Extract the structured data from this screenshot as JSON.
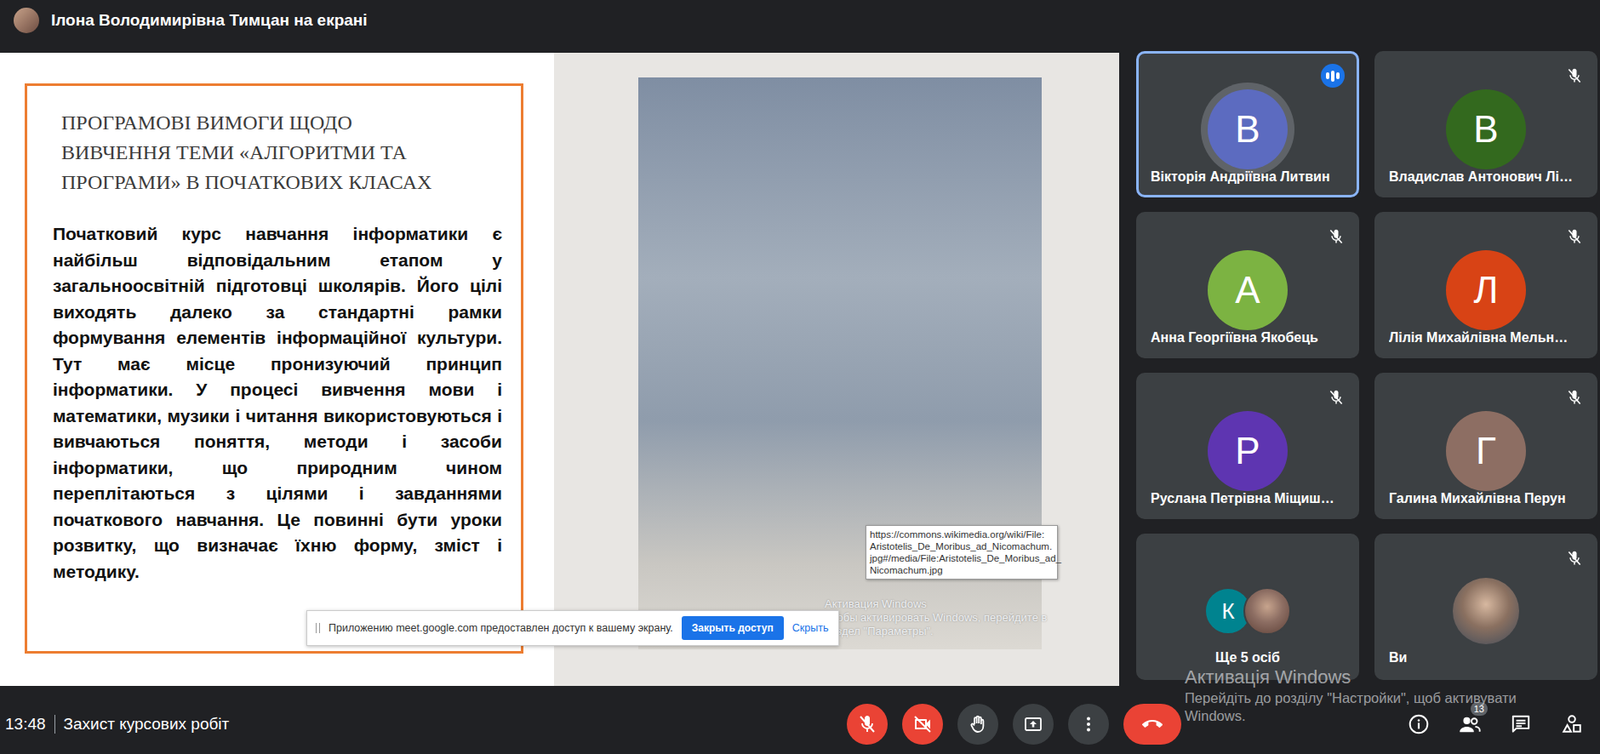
{
  "top_bar": {
    "presenter": "Ілона Володимирівна Тимцан на екрані"
  },
  "slide": {
    "title_lines": [
      "ПРОГРАМОВІ ВИМОГИ ЩОДО",
      "ВИВЧЕННЯ ТЕМИ «АЛГОРИТМИ ТА",
      "ПРОГРАМИ» В ПОЧАТКОВИХ КЛАСАХ"
    ],
    "body": "Початковий курс навчання інформатики є найбільш відповідальним етапом у загальноосвітній підготовці школярів. Його цілі виходять далеко за стандартні рамки формування елементів інформаційної культури. Тут має місце пронизуючий принцип інформатики. У процесі вивчення мови і математики, музики і читання використовуються і вивчаються поняття, методи і засоби інформатики, що природним чином переплітаються з цілями і завданнями початкового навчання. Це повинні бути уроки розвитку, що визначає їхню форму, зміст і методику."
  },
  "tooltip_lines": [
    "https://commons.wikimedia.org/wiki/File:",
    "Aristotelis_De_Moribus_ad_Nicomachum.",
    "jpg#/media/File:Aristotelis_De_Moribus_ad_",
    "Nicomachum.jpg"
  ],
  "shared_watermark": [
    "Активация Windows",
    "Чтобы активировать Windows, перейдите в",
    "раздел \"Параметры\"."
  ],
  "share_bar": {
    "message": "Приложению meet.google.com предоставлен доступ к вашему экрану.",
    "stop_button": "Закрыть доступ",
    "hide_link": "Скрыть"
  },
  "participants": [
    {
      "kind": "person",
      "initial": "В",
      "name": "Вікторія Андріївна Литвин",
      "color": "#5c6bc0",
      "muted": false,
      "speaking": true
    },
    {
      "kind": "person",
      "initial": "В",
      "name": "Владислав Антонович Лі…",
      "color": "#33691e",
      "muted": true,
      "speaking": false
    },
    {
      "kind": "person",
      "initial": "А",
      "name": "Анна Георгіївна Якобець",
      "color": "#7cb342",
      "muted": true,
      "speaking": false
    },
    {
      "kind": "person",
      "initial": "Л",
      "name": "Лілія Михайлівна Мельн…",
      "color": "#d84315",
      "muted": true,
      "speaking": false
    },
    {
      "kind": "person",
      "initial": "Р",
      "name": "Руслана Петрівна Міщиш…",
      "color": "#5e35b1",
      "muted": true,
      "speaking": false
    },
    {
      "kind": "person",
      "initial": "Г",
      "name": "Галина Михайлівна Перун",
      "color": "#8d6e63",
      "muted": true,
      "speaking": false
    },
    {
      "kind": "group",
      "name": "Ще 5 осіб",
      "muted": false,
      "speaking": false,
      "avatars": [
        {
          "kind": "initial",
          "initial": "К",
          "color": "#00838f"
        },
        {
          "kind": "photo"
        }
      ]
    },
    {
      "kind": "self",
      "name": "Ви",
      "muted": true,
      "speaking": false
    }
  ],
  "bottom_bar": {
    "time": "13:48",
    "meeting": "Захист курсових робіт",
    "people_count": "13"
  },
  "controls": [
    {
      "kind": "mic",
      "off": true
    },
    {
      "kind": "camera",
      "off": true
    },
    {
      "kind": "hand",
      "off": false
    },
    {
      "kind": "present",
      "off": false
    },
    {
      "kind": "more",
      "off": false
    },
    {
      "kind": "hangup",
      "off": false
    }
  ],
  "windows_watermark": {
    "title": "Активація Windows",
    "lines": [
      "Перейдіть до розділу \"Настройки\", щоб активувати",
      "Windows."
    ]
  }
}
